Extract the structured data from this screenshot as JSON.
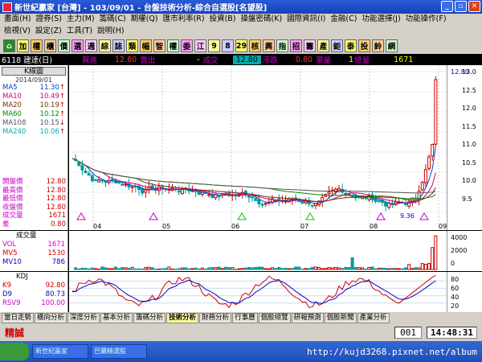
{
  "window": {
    "title": "新世紀贏家 [台灣] - 103/09/01 - 台盤技術分析-綜合自選股[名望股]",
    "minimize": "_",
    "restore": "▫",
    "close": "✕"
  },
  "menu": {
    "row1": [
      "畫面(H)",
      "證券(S)",
      "主力(M)",
      "籌碼(C)",
      "期權(Q)",
      "匯市利率(R)",
      "投資(B)",
      "操盤密碼(K)",
      "國際資訊(I)",
      "金融(C)",
      "功能選擇(J)",
      "功能操作(F)"
    ],
    "row2": [
      "檢視(V)",
      "設定(Z)",
      "工具(T)",
      "說明(H)"
    ]
  },
  "toolbar": [
    "加",
    "權",
    "櫃",
    "價",
    "選",
    "週",
    "綜",
    "誌",
    "類",
    "幅",
    "智",
    "權",
    "委",
    "江",
    "9",
    "8",
    "29",
    "核",
    "興",
    "指",
    "招",
    "籌",
    "產",
    "鉅",
    "泰",
    "投",
    "鈴",
    "網"
  ],
  "quote": {
    "code": "6118 建達(日)",
    "buy_label": "買進",
    "buy": "12.80",
    "sell_label": "賣出",
    "sell": "-",
    "last_label": "成交",
    "last": "12.80",
    "change_label": "漲跌",
    "change": "0.80",
    "vol_label": "單量",
    "vol": "1",
    "total_label": "總量",
    "total": "1671"
  },
  "left": {
    "header": "K線圖",
    "date": "2014/09/01",
    "ma": [
      {
        "label": "MA5",
        "value": "11.30",
        "arrow": "↑",
        "color": "#0044cc"
      },
      {
        "label": "MA10",
        "value": "10.49",
        "arrow": "↑",
        "color": "#d0006f"
      },
      {
        "label": "MA20",
        "value": "10.19",
        "arrow": "↑",
        "color": "#7a2b00"
      },
      {
        "label": "MA60",
        "value": "10.12",
        "arrow": "↑",
        "color": "#008800"
      },
      {
        "label": "MA108",
        "value": "10.15",
        "arrow": "↓",
        "color": "#555555"
      },
      {
        "label": "MA240",
        "value": "10.06",
        "arrow": "↑",
        "color": "#00aaaa"
      }
    ],
    "ohlc": [
      {
        "label": "開盤價",
        "value": "12.80"
      },
      {
        "label": "最高價",
        "value": "12.80"
      },
      {
        "label": "最低價",
        "value": "12.80"
      },
      {
        "label": "收盤價",
        "value": "12.80"
      },
      {
        "label": "成交量",
        "value": "1671"
      },
      {
        "label": "差",
        "value": "0.80"
      }
    ],
    "vol_header": "成交量",
    "vol": [
      {
        "label": "VOL",
        "value": "1671"
      },
      {
        "label": "MV5",
        "value": "1530"
      },
      {
        "label": "MV10",
        "value": "786"
      }
    ],
    "kd_header": "KDJ",
    "kd": [
      {
        "label": "K9",
        "value": "92.80"
      },
      {
        "label": "D9",
        "value": "80.73"
      },
      {
        "label": "RSV9",
        "value": "100.00"
      }
    ]
  },
  "axis": {
    "price_ticks": [
      "13.0",
      "12.5",
      "12.0",
      "11.5",
      "11.0",
      "10.5",
      "10.0",
      "9.5"
    ],
    "top_price": "12.80",
    "vol_ticks": [
      "4000",
      "2000",
      "0"
    ],
    "kd_ticks": [
      "80",
      "60",
      "40",
      "20"
    ],
    "months": [
      "04",
      "05",
      "06",
      "07",
      "08",
      "09"
    ],
    "low_label": "9.36"
  },
  "colors": {
    "up": "#cc0000",
    "down": "#009999",
    "k": "#cc0000",
    "d": "#0000cc"
  },
  "tabs": [
    "當日走勢",
    "橫向分析",
    "深度分析",
    "基本分析",
    "籌碼分析",
    "技術分析",
    "財務分析",
    "行事曆",
    "個股總覽",
    "研報預測",
    "個股新聞",
    "產業分析"
  ],
  "active_tab": "技術分析",
  "status": {
    "brand": "精誠",
    "code": "001",
    "clock": "14:48:31"
  },
  "taskbar": {
    "tasks": [
      "新世紀贏家",
      "巴蘭精選股"
    ],
    "url": "http://kujd3268.pixnet.net/album"
  }
}
